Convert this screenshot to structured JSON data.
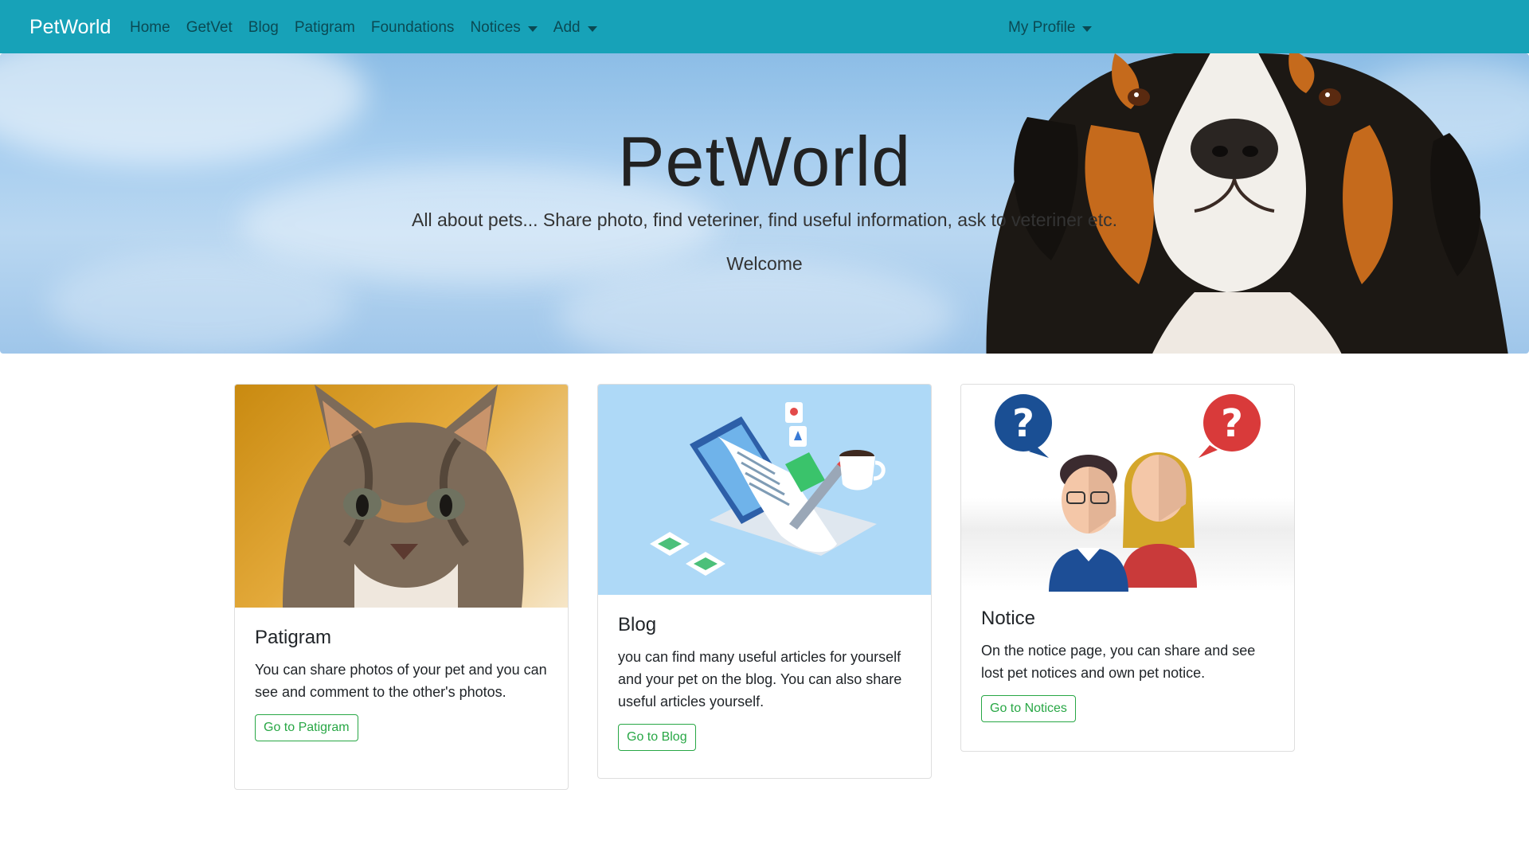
{
  "navbar": {
    "brand": "PetWorld",
    "links": [
      "Home",
      "GetVet",
      "Blog",
      "Patigram",
      "Foundations"
    ],
    "dropdowns": [
      "Notices",
      "Add"
    ],
    "profile": "My Profile",
    "bg_color": "#17a2b8"
  },
  "hero": {
    "title": "PetWorld",
    "subtitle": "All about pets... Share photo, find veteriner, find useful information, ask to veteriner etc.",
    "welcome": "Welcome"
  },
  "cards": [
    {
      "title": "Patigram",
      "text": "You can share photos of your pet and you can see and comment to the other's photos.",
      "button": "Go to Patigram",
      "image": "kitten-photo"
    },
    {
      "title": "Blog",
      "text": "you can find many useful articles for yourself and your pet on the blog. You can also share useful articles yourself.",
      "button": "Go to Blog",
      "image": "laptop-blog-illustration"
    },
    {
      "title": "Notice",
      "text": "On the notice page, you can share and see lost pet notices and own pet notice.",
      "button": "Go to Notices",
      "image": "question-people-illustration"
    }
  ],
  "colors": {
    "primary_nav": "#17a2b8",
    "button_outline": "#28a745"
  }
}
